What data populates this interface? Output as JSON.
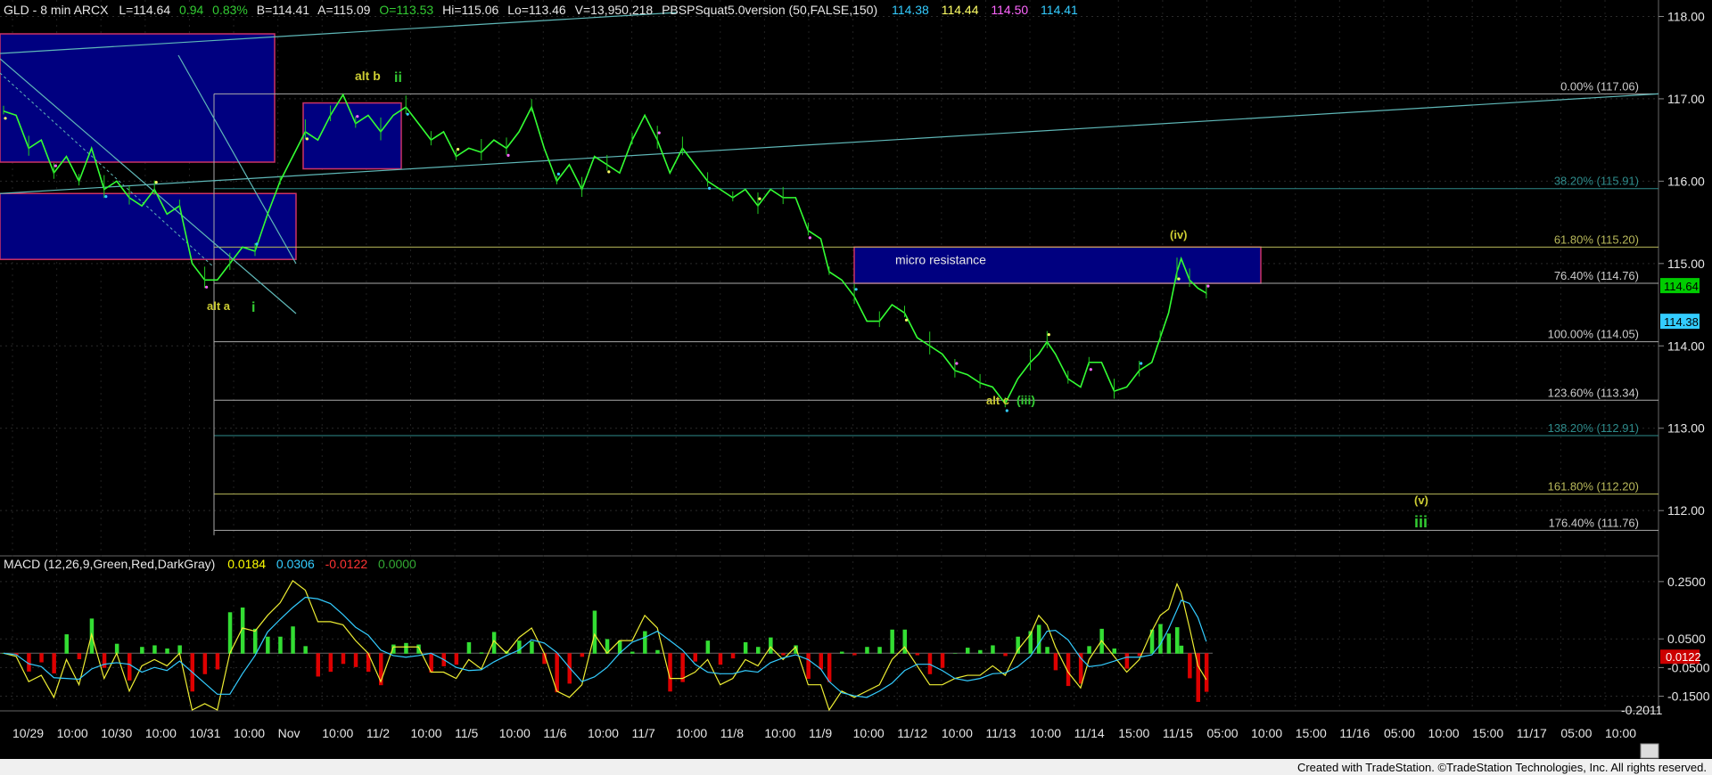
{
  "header": {
    "symbol_info": "GLD - 8 min  ARCX",
    "last": "L=114.64",
    "change": "0.94",
    "change_pct": "0.83%",
    "bid": "B=114.41",
    "ask": "A=115.09",
    "open": "O=113.53",
    "high": "Hi=115.06",
    "low": "Lo=113.46",
    "volume": "V=13,950,218",
    "indicator": "PBSPSquat5.0version (50,FALSE,150)",
    "ind_values": [
      "114.38",
      "114.44",
      "114.50",
      "114.41"
    ],
    "ind_colors": [
      "#33ccff",
      "#ffff66",
      "#ff66ff",
      "#33ccff"
    ]
  },
  "macd_header": {
    "label": "MACD (12,26,9,Green,Red,DarkGray)",
    "values": [
      "0.0184",
      "0.0306",
      "-0.0122",
      "0.0000"
    ],
    "colors": [
      "#ffff00",
      "#33ccff",
      "#ff3333",
      "#33aa33"
    ]
  },
  "footer": {
    "credit": "Created with TradeStation. ©TradeStation Technologies, Inc. All rights reserved."
  },
  "chart_data": [
    {
      "type": "line",
      "title": "GLD - 8 min",
      "xlabel": "",
      "ylabel": "",
      "ylim": [
        111.45,
        118.2
      ],
      "y_ticks": [
        112.0,
        113.0,
        114.0,
        115.0,
        116.0,
        117.0,
        118.0
      ],
      "y_tick_labels": [
        "112.00",
        "113.00",
        "114.00",
        "115.00",
        "116.00",
        "117.00",
        "118.00"
      ],
      "x_tick_labels": [
        "10/29",
        "10:00",
        "10/30",
        "10:00",
        "10/31",
        "10:00",
        "Nov",
        "10:00",
        "11/2",
        "10:00",
        "11/5",
        "10:00",
        "11/6",
        "10:00",
        "11/7",
        "10:00",
        "11/8",
        "10:00",
        "11/9",
        "10:00",
        "11/12",
        "10:00",
        "11/13",
        "10:00",
        "11/14",
        "15:00",
        "11/15",
        "05:00",
        "10:00",
        "15:00",
        "11/16",
        "05:00",
        "10:00",
        "15:00",
        "11/17",
        "05:00",
        "10:00"
      ],
      "grid": true,
      "legend": "none",
      "price_path": [
        [
          0,
          116.85
        ],
        [
          3,
          116.8
        ],
        [
          6,
          116.4
        ],
        [
          9,
          116.5
        ],
        [
          12,
          116.1
        ],
        [
          15,
          116.3
        ],
        [
          18,
          116.0
        ],
        [
          21,
          116.4
        ],
        [
          24,
          115.9
        ],
        [
          27,
          116.0
        ],
        [
          30,
          115.8
        ],
        [
          33,
          115.7
        ],
        [
          36,
          115.9
        ],
        [
          39,
          115.6
        ],
        [
          42,
          115.7
        ],
        [
          45,
          115.0
        ],
        [
          48,
          114.8
        ],
        [
          51,
          114.8
        ],
        [
          54,
          115.0
        ],
        [
          57,
          115.2
        ],
        [
          60,
          115.15
        ],
        [
          63,
          115.6
        ],
        [
          66,
          116.0
        ],
        [
          69,
          116.3
        ],
        [
          72,
          116.6
        ],
        [
          75,
          116.5
        ],
        [
          78,
          116.8
        ],
        [
          81,
          117.05
        ],
        [
          84,
          116.7
        ],
        [
          87,
          116.8
        ],
        [
          90,
          116.6
        ],
        [
          93,
          116.8
        ],
        [
          96,
          116.9
        ],
        [
          99,
          116.7
        ],
        [
          102,
          116.5
        ],
        [
          105,
          116.6
        ],
        [
          108,
          116.3
        ],
        [
          111,
          116.4
        ],
        [
          114,
          116.35
        ],
        [
          117,
          116.5
        ],
        [
          120,
          116.4
        ],
        [
          123,
          116.6
        ],
        [
          126,
          116.9
        ],
        [
          129,
          116.4
        ],
        [
          132,
          116.0
        ],
        [
          135,
          116.2
        ],
        [
          138,
          115.9
        ],
        [
          141,
          116.3
        ],
        [
          144,
          116.2
        ],
        [
          147,
          116.1
        ],
        [
          150,
          116.5
        ],
        [
          153,
          116.8
        ],
        [
          156,
          116.5
        ],
        [
          159,
          116.1
        ],
        [
          162,
          116.4
        ],
        [
          165,
          116.2
        ],
        [
          168,
          116.0
        ],
        [
          171,
          115.9
        ],
        [
          174,
          115.8
        ],
        [
          177,
          115.9
        ],
        [
          180,
          115.7
        ],
        [
          183,
          115.9
        ],
        [
          186,
          115.8
        ],
        [
          189,
          115.8
        ],
        [
          192,
          115.4
        ],
        [
          195,
          115.3
        ],
        [
          197,
          114.9
        ],
        [
          200,
          114.8
        ],
        [
          203,
          114.6
        ],
        [
          206,
          114.3
        ],
        [
          209,
          114.3
        ],
        [
          212,
          114.5
        ],
        [
          215,
          114.4
        ],
        [
          218,
          114.1
        ],
        [
          221,
          114.0
        ],
        [
          224,
          113.9
        ],
        [
          227,
          113.7
        ],
        [
          230,
          113.65
        ],
        [
          233,
          113.55
        ],
        [
          236,
          113.5
        ],
        [
          239,
          113.3
        ],
        [
          242,
          113.6
        ],
        [
          245,
          113.8
        ],
        [
          247,
          113.9
        ],
        [
          249,
          114.05
        ],
        [
          251,
          113.9
        ],
        [
          254,
          113.6
        ],
        [
          257,
          113.5
        ],
        [
          259,
          113.8
        ],
        [
          262,
          113.8
        ],
        [
          265,
          113.45
        ],
        [
          268,
          113.5
        ],
        [
          271,
          113.7
        ],
        [
          274,
          113.8
        ],
        [
          276,
          114.1
        ],
        [
          278,
          114.4
        ],
        [
          280,
          114.9
        ],
        [
          281,
          115.06
        ],
        [
          283,
          114.8
        ],
        [
          285,
          114.7
        ],
        [
          287,
          114.64
        ]
      ],
      "series": [
        {
          "values": [
            114.38,
            114.44,
            114.5,
            114.41
          ]
        }
      ],
      "levels": [
        {
          "label": "0.00% (117.06)",
          "value": 117.06,
          "color": "#cccccc"
        },
        {
          "label": "38.20% (115.91)",
          "value": 115.91,
          "color": "#2e8b8b"
        },
        {
          "label": "61.80% (115.20)",
          "value": 115.2,
          "color": "#b8b85a"
        },
        {
          "label": "76.40% (114.76)",
          "value": 114.76,
          "color": "#cccccc"
        },
        {
          "label": "100.00% (114.05)",
          "value": 114.05,
          "color": "#cccccc"
        },
        {
          "label": "123.60% (113.34)",
          "value": 113.34,
          "color": "#cccccc"
        },
        {
          "label": "138.20% (112.91)",
          "value": 112.91,
          "color": "#2e8b8b"
        },
        {
          "label": "161.80% (112.20)",
          "value": 112.2,
          "color": "#b8b85a"
        },
        {
          "label": "176.40% (111.76)",
          "value": 111.76,
          "color": "#cccccc"
        }
      ],
      "zones": [
        {
          "label": "micro resistance",
          "top": 115.2,
          "bottom": 114.76
        }
      ],
      "price_tags": [
        {
          "value": "114.64",
          "price": 114.64,
          "bg": "#00cc00"
        },
        {
          "value": "114.38",
          "price": 114.38,
          "bg": "#33ccff"
        }
      ],
      "wave_labels": [
        {
          "text": "alt b",
          "color": "#cccc33"
        },
        {
          "text": "ii",
          "color": "#33cc33"
        },
        {
          "text": "alt a",
          "color": "#cccc33"
        },
        {
          "text": "i",
          "color": "#33cc33"
        },
        {
          "text": "alt c",
          "color": "#cccc33"
        },
        {
          "text": "(iii)",
          "color": "#33cc33"
        },
        {
          "text": "(iv)",
          "color": "#cccc33"
        },
        {
          "text": "(v)",
          "color": "#cccc33"
        },
        {
          "text": "iii",
          "color": "#33cc33"
        }
      ]
    },
    {
      "type": "line",
      "title": "MACD (12,26,9,Green,Red,DarkGray)",
      "ylim": [
        -0.2011,
        0.29
      ],
      "y_ticks": [
        0.25,
        0.05,
        -0.05,
        -0.15
      ],
      "y_tick_labels": [
        "0.2500",
        "0.0500",
        "-0.0500",
        "-0.1500"
      ],
      "extra_labels": [
        "-0.2011",
        "0.0122"
      ],
      "series": [
        {
          "values": [
            0.0184,
            0.0306,
            -0.0122,
            0.0
          ]
        }
      ]
    }
  ]
}
